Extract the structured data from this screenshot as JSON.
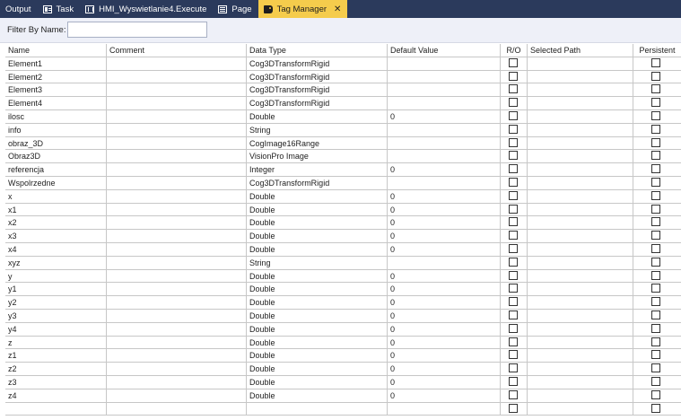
{
  "tabs": [
    {
      "label": "Output",
      "icon": "none",
      "active": false
    },
    {
      "label": "Task",
      "icon": "task-icon",
      "active": false
    },
    {
      "label": "HMI_Wyswietlanie4.Execute",
      "icon": "hmi-icon",
      "active": false
    },
    {
      "label": "Page",
      "icon": "page-icon",
      "active": false
    },
    {
      "label": "Tag Manager",
      "icon": "tag-icon",
      "active": true,
      "close": "✕"
    }
  ],
  "filter": {
    "label": "Filter By Name:",
    "value": ""
  },
  "columns": [
    "Name",
    "Comment",
    "Data Type",
    "Default Value",
    "R/O",
    "Selected Path",
    "Persistent"
  ],
  "rows": [
    {
      "name": "Element1",
      "comment": "",
      "type": "Cog3DTransformRigid",
      "default": ""
    },
    {
      "name": "Element2",
      "comment": "",
      "type": "Cog3DTransformRigid",
      "default": ""
    },
    {
      "name": "Element3",
      "comment": "",
      "type": "Cog3DTransformRigid",
      "default": ""
    },
    {
      "name": "Element4",
      "comment": "",
      "type": "Cog3DTransformRigid",
      "default": ""
    },
    {
      "name": "ilosc",
      "comment": "",
      "type": "Double",
      "default": "0"
    },
    {
      "name": "info",
      "comment": "",
      "type": "String",
      "default": ""
    },
    {
      "name": "obraz_3D",
      "comment": "",
      "type": "CogImage16Range",
      "default": ""
    },
    {
      "name": "Obraz3D",
      "comment": "",
      "type": "VisionPro Image",
      "default": ""
    },
    {
      "name": "referencja",
      "comment": "",
      "type": "Integer",
      "default": "0"
    },
    {
      "name": "Wspolrzedne",
      "comment": "",
      "type": "Cog3DTransformRigid",
      "default": ""
    },
    {
      "name": "x",
      "comment": "",
      "type": "Double",
      "default": "0"
    },
    {
      "name": "x1",
      "comment": "",
      "type": "Double",
      "default": "0"
    },
    {
      "name": "x2",
      "comment": "",
      "type": "Double",
      "default": "0"
    },
    {
      "name": "x3",
      "comment": "",
      "type": "Double",
      "default": "0"
    },
    {
      "name": "x4",
      "comment": "",
      "type": "Double",
      "default": "0"
    },
    {
      "name": "xyz",
      "comment": "",
      "type": "String",
      "default": ""
    },
    {
      "name": "y",
      "comment": "",
      "type": "Double",
      "default": "0"
    },
    {
      "name": "y1",
      "comment": "",
      "type": "Double",
      "default": "0"
    },
    {
      "name": "y2",
      "comment": "",
      "type": "Double",
      "default": "0"
    },
    {
      "name": "y3",
      "comment": "",
      "type": "Double",
      "default": "0"
    },
    {
      "name": "y4",
      "comment": "",
      "type": "Double",
      "default": "0"
    },
    {
      "name": "z",
      "comment": "",
      "type": "Double",
      "default": "0"
    },
    {
      "name": "z1",
      "comment": "",
      "type": "Double",
      "default": "0"
    },
    {
      "name": "z2",
      "comment": "",
      "type": "Double",
      "default": "0"
    },
    {
      "name": "z3",
      "comment": "",
      "type": "Double",
      "default": "0"
    },
    {
      "name": "z4",
      "comment": "",
      "type": "Double",
      "default": "0"
    },
    {
      "name": "",
      "comment": "",
      "type": "",
      "default": ""
    }
  ],
  "colors": {
    "tabstrip": "#2b3a5c",
    "active_tab": "#f5cc4c",
    "filter_bg": "#eef0f8",
    "gridline": "#c7c7c7"
  }
}
